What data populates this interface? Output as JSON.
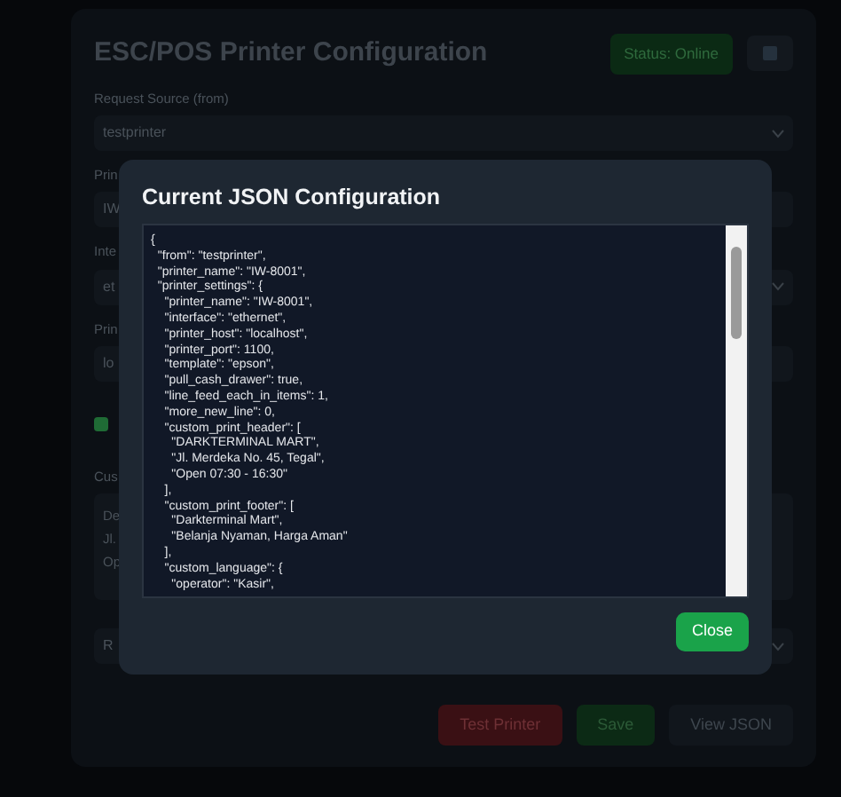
{
  "page": {
    "title": "ESC/POS Printer Configuration",
    "status_badge": "Status: Online",
    "fields": [
      {
        "kind": "select",
        "label": "Request Source (from)",
        "value": "testprinter"
      },
      {
        "kind": "input",
        "label": "Prin",
        "value": "IW"
      },
      {
        "kind": "select",
        "label": "Inte",
        "value": "et"
      },
      {
        "kind": "input",
        "label": "Prin",
        "value": "lo"
      },
      {
        "kind": "checkbox",
        "checked": true
      },
      {
        "kind": "textarea",
        "label": "Cus",
        "lines": [
          "De",
          "Jl.",
          "Op"
        ]
      },
      {
        "kind": "select",
        "value": "R"
      }
    ],
    "buttons": [
      {
        "label": "Test Printer",
        "kind": "danger"
      },
      {
        "label": "Save",
        "kind": "success"
      },
      {
        "label": "View JSON",
        "kind": "secondary"
      }
    ]
  },
  "modal": {
    "title": "Current JSON Configuration",
    "json_lines": [
      "{",
      "  \"from\": \"testprinter\",",
      "  \"printer_name\": \"IW-8001\",",
      "  \"printer_settings\": {",
      "    \"printer_name\": \"IW-8001\",",
      "    \"interface\": \"ethernet\",",
      "    \"printer_host\": \"localhost\",",
      "    \"printer_port\": 1100,",
      "    \"template\": \"epson\",",
      "    \"pull_cash_drawer\": true,",
      "    \"line_feed_each_in_items\": 1,",
      "    \"more_new_line\": 0,",
      "    \"custom_print_header\": [",
      "      \"DARKTERMINAL MART\",",
      "      \"Jl. Merdeka No. 45, Tegal\",",
      "      \"Open 07:30 - 16:30\"",
      "    ],",
      "    \"custom_print_footer\": [",
      "      \"Darkterminal Mart\",",
      "      \"Belanja Nyaman, Harga Aman\"",
      "    ],",
      "    \"custom_language\": {",
      "      \"operator\": \"Kasir\","
    ],
    "close_button": "Close"
  }
}
